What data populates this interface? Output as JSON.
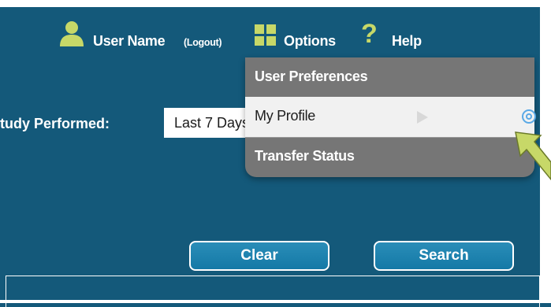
{
  "header": {
    "user_name": "User Name",
    "logout_label": "(Logout)",
    "options_label": "Options",
    "help_label": "Help"
  },
  "filters": {
    "study_performed_label": "tudy Performed:",
    "date_range_value": "Last 7 Days"
  },
  "options_menu": {
    "items": [
      {
        "label": "User Preferences",
        "state": "default"
      },
      {
        "label": "My Profile",
        "state": "hover"
      },
      {
        "label": "Transfer Status",
        "state": "default"
      }
    ]
  },
  "actions": {
    "clear_label": "Clear",
    "search_label": "Search"
  },
  "icons": {
    "user": "user-icon",
    "options": "grid-icon",
    "help": "question-mark-icon",
    "menu_item_side": "gear-icon",
    "annotation": "pointer-arrow-icon"
  },
  "colors": {
    "background": "#14597a",
    "icon_accent": "#c7d868",
    "menu_background": "#767676",
    "menu_hover": "#f1f1f1",
    "button": "#1a82ae"
  }
}
